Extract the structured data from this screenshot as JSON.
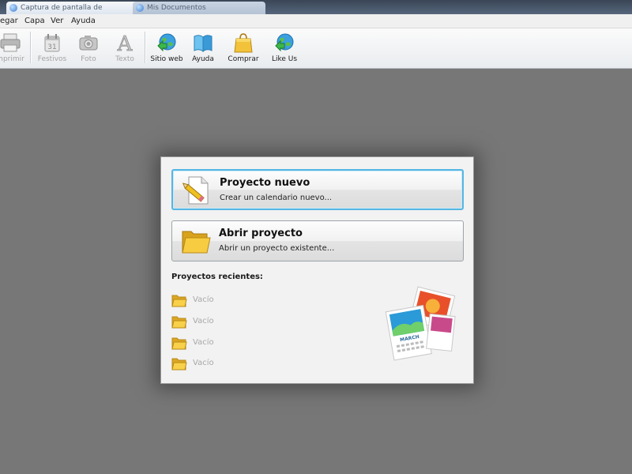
{
  "window": {
    "tabs": [
      {
        "label": "Captura de pantalla de"
      },
      {
        "label": "Mis Documentos"
      }
    ]
  },
  "menu": {
    "items": [
      "egar",
      "Capa",
      "Ver",
      "Ayuda"
    ]
  },
  "toolbar": {
    "buttons": [
      {
        "label": "mprimir",
        "icon": "printer-icon",
        "enabled": false
      },
      {
        "label": "Festivos",
        "icon": "calendar-icon",
        "enabled": false
      },
      {
        "label": "Foto",
        "icon": "camera-icon",
        "enabled": false
      },
      {
        "label": "Texto",
        "icon": "text-icon",
        "enabled": false
      },
      {
        "label": "Sitio web",
        "icon": "globe-arrow-icon",
        "enabled": true
      },
      {
        "label": "Ayuda",
        "icon": "book-icon",
        "enabled": true
      },
      {
        "label": "Comprar",
        "icon": "shopping-bag-icon",
        "enabled": true
      },
      {
        "label": "Like Us",
        "icon": "globe-arrow-icon",
        "enabled": true
      }
    ]
  },
  "dialog": {
    "new_project": {
      "title": "Proyecto nuevo",
      "subtitle": "Crear un calendario nuevo..."
    },
    "open_project": {
      "title": "Abrir proyecto",
      "subtitle": "Abrir un proyecto existente..."
    },
    "recent_title": "Proyectos recientes:",
    "recent_items": [
      "Vacío",
      "Vacío",
      "Vacío",
      "Vacío"
    ],
    "illustration_month": "MARCH"
  },
  "colors": {
    "workspace": "#777777",
    "focus_border": "#56b6e3",
    "folder": "#f3c230"
  }
}
